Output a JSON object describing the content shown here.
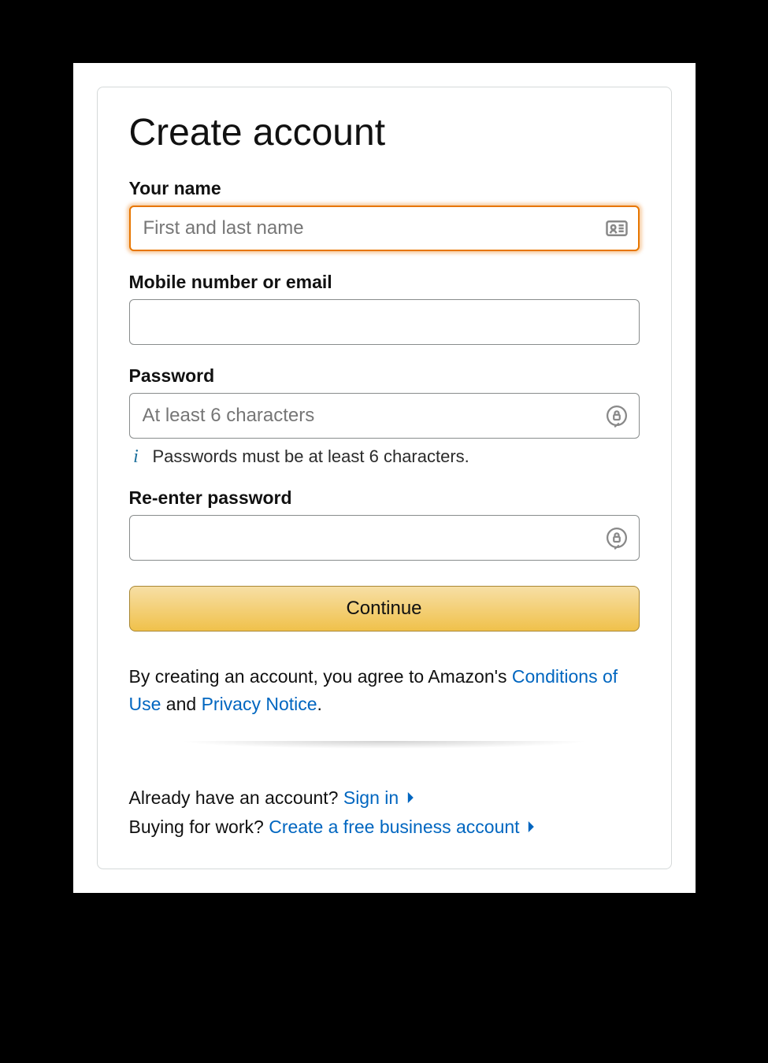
{
  "title": "Create account",
  "fields": {
    "name": {
      "label": "Your name",
      "placeholder": "First and last name",
      "value": ""
    },
    "contact": {
      "label": "Mobile number or email",
      "placeholder": "",
      "value": ""
    },
    "password": {
      "label": "Password",
      "placeholder": "At least 6 characters",
      "value": "",
      "hint": "Passwords must be at least 6 characters."
    },
    "password2": {
      "label": "Re-enter password",
      "placeholder": "",
      "value": ""
    }
  },
  "continue_label": "Continue",
  "legal": {
    "prefix": "By creating an account, you agree to Amazon's ",
    "conditions": "Conditions of Use",
    "middle": " and ",
    "privacy": "Privacy Notice",
    "suffix": "."
  },
  "bottom": {
    "line1_prefix": "Already have an account? ",
    "signin": "Sign in",
    "line2_prefix": "Buying for work? ",
    "business": "Create a free business account"
  }
}
